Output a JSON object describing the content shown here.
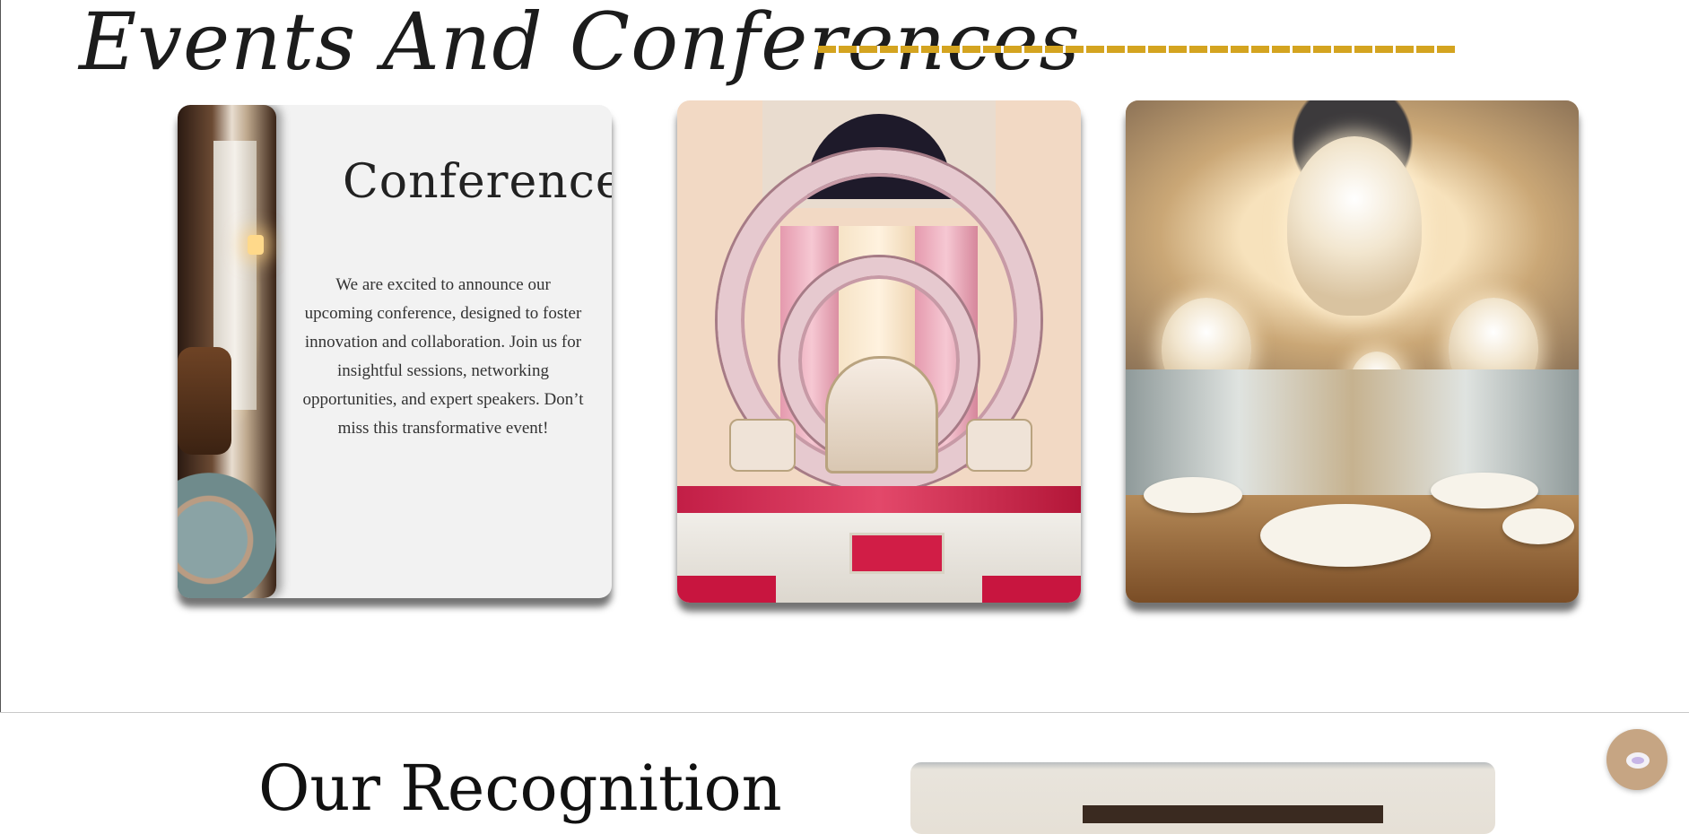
{
  "events_section": {
    "title": "Events And Conferences",
    "accent_color": "#d4a420"
  },
  "conference_card": {
    "heading": "Conference",
    "description": "We are excited to announce our upcoming conference, designed to foster innovation and collaboration. Join us for insightful sessions, networking opportunities, and expert speakers. Don’t miss this transformative event!"
  },
  "recognition_section": {
    "title": "Our Recognition"
  },
  "chat_widget": {
    "icon": "chat-bubble-icon",
    "color": "#c6a583"
  }
}
